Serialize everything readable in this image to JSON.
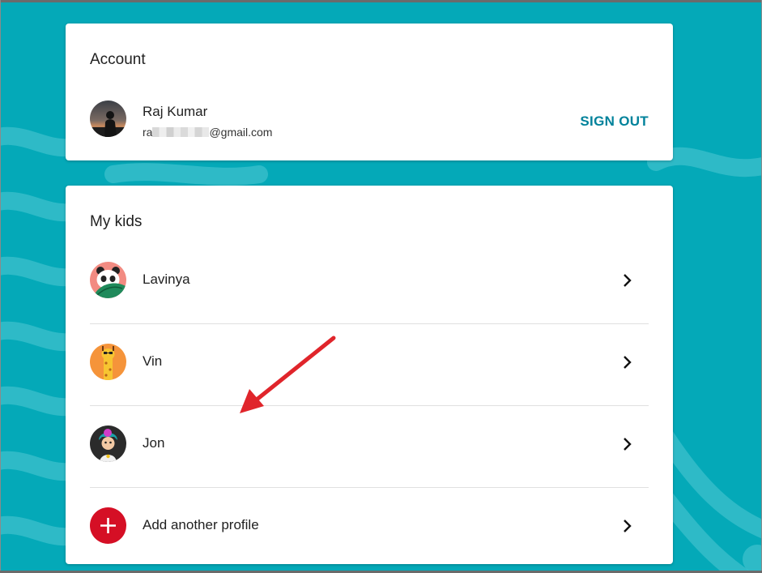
{
  "account": {
    "title": "Account",
    "user_name": "Raj Kumar",
    "email_prefix": "ra",
    "email_suffix": "@gmail.com",
    "sign_out_label": "SIGN OUT"
  },
  "kids": {
    "title": "My kids",
    "profiles": [
      {
        "name": "Lavinya",
        "avatar_icon": "panda-leaf-avatar-icon"
      },
      {
        "name": "Vin",
        "avatar_icon": "giraffe-avatar-icon"
      },
      {
        "name": "Jon",
        "avatar_icon": "pink-hair-kid-avatar-icon"
      }
    ],
    "add_profile_label": "Add another profile"
  },
  "colors": {
    "background": "#04a9b8",
    "accent": "#00829b",
    "add_button": "#d50f25",
    "annotation_arrow": "#e0252b"
  }
}
